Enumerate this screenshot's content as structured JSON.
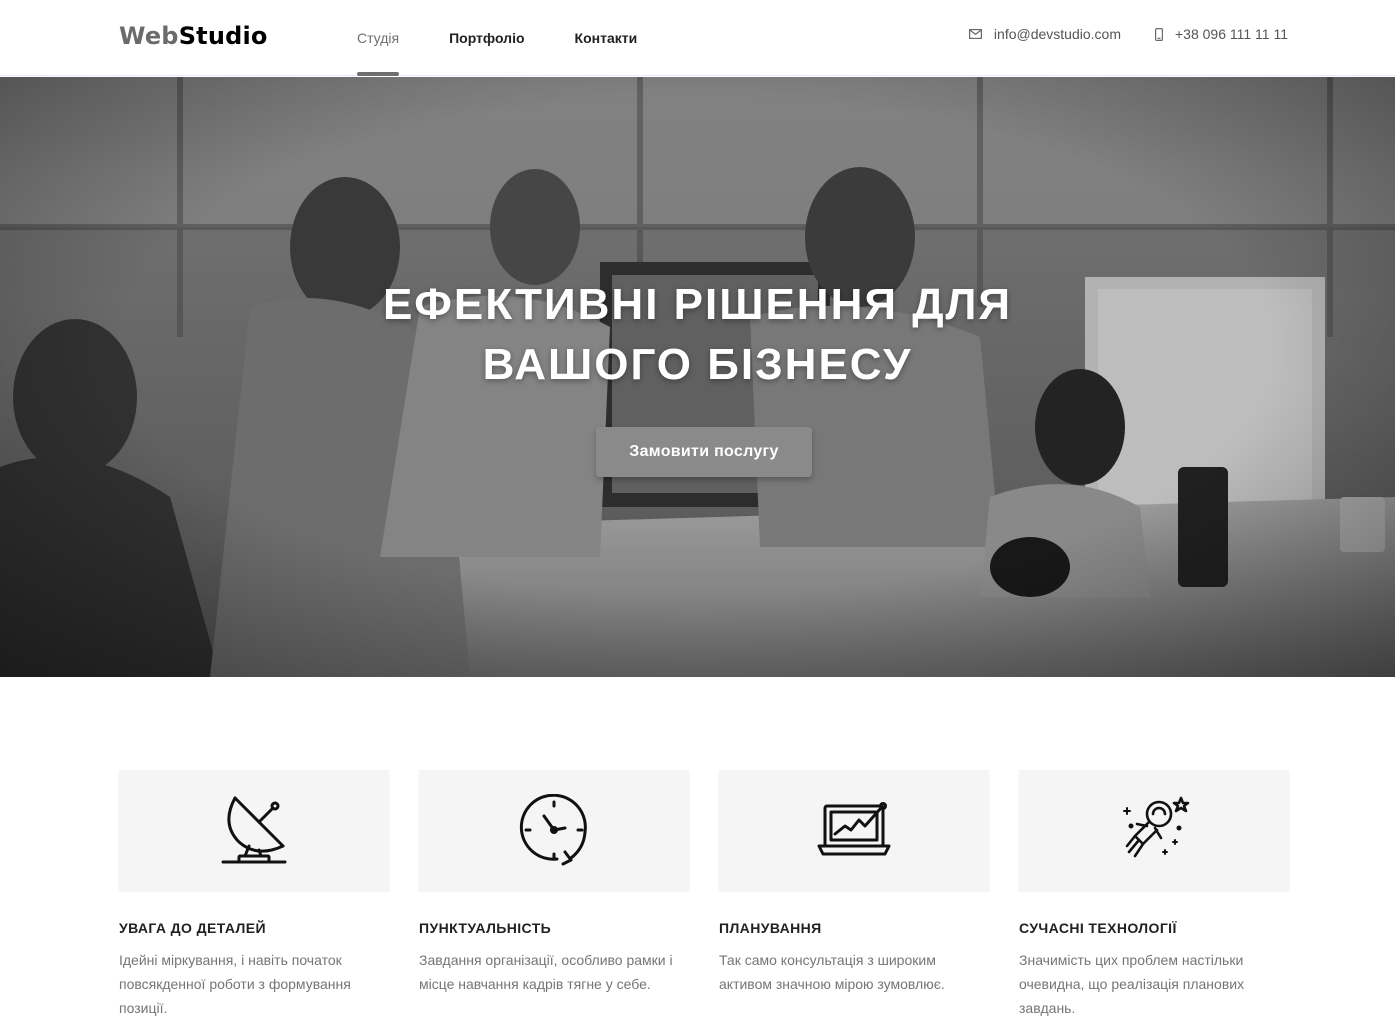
{
  "brand": {
    "part1": "Web",
    "part2": "Studio"
  },
  "nav": {
    "items": [
      {
        "label": "Студія",
        "active": true
      },
      {
        "label": "Портфоліо",
        "active": false
      },
      {
        "label": "Контакти",
        "active": false
      }
    ]
  },
  "contacts": {
    "email": "info@devstudio.com",
    "phone": "+38 096 111 11 11"
  },
  "hero": {
    "title_line1": "ЕФЕКТИВНІ РІШЕННЯ ДЛЯ",
    "title_line2": "ВАШОГО БІЗНЕСУ",
    "button": "Замовити послугу"
  },
  "features": [
    {
      "icon": "satellite-dish-icon",
      "title": "УВАГА ДО ДЕТАЛЕЙ",
      "text": "Ідейні міркування, і навіть початок повсякденної роботи з формування позиції."
    },
    {
      "icon": "clock-icon",
      "title": "ПУНКТУАЛЬНІСТЬ",
      "text": "Завдання організації, особливо рамки і місце навчання кадрів тягне у себе."
    },
    {
      "icon": "laptop-chart-icon",
      "title": "ПЛАНУВАННЯ",
      "text": "Так само консультація з широким активом значною мірою зумовлює."
    },
    {
      "icon": "astronaut-icon",
      "title": "СУЧАСНІ ТЕХНОЛОГІЇ",
      "text": "Значимість цих проблем настільки очевидна, що реалізація планових завдань."
    }
  ],
  "colors": {
    "accent": "#6f6f6f",
    "button": "#8a8a8a",
    "feature_bg": "#f5f5f5",
    "text_muted": "#757575"
  }
}
